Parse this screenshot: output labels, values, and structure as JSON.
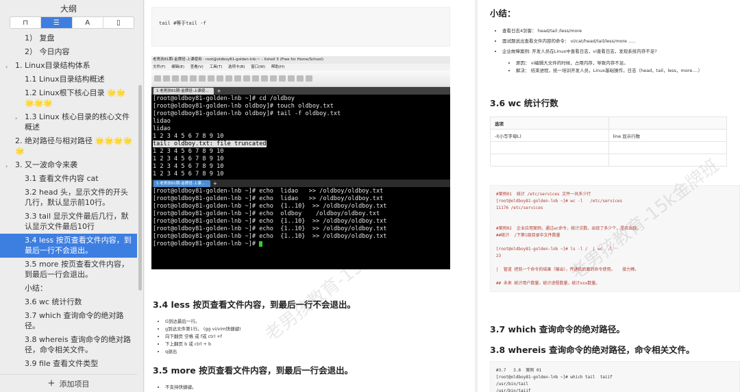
{
  "sidebar": {
    "title": "大纲",
    "tabs": [
      "⊓",
      "☰",
      "A",
      "▯"
    ],
    "outline": [
      {
        "label": "1） 复盘",
        "level": 2,
        "arrow": false
      },
      {
        "label": "2） 今日内容",
        "level": 2,
        "arrow": false
      },
      {
        "label": "1. Linux目录结构体系",
        "level": 1,
        "arrow": true
      },
      {
        "label": "1.1 Linux目录结构概述",
        "level": 2,
        "arrow": false
      },
      {
        "label": "1.2 Linux根下核心目录 🌟🌟🌟🌟🌟",
        "level": 2,
        "arrow": false
      },
      {
        "label": "1.3 Linux 核心目录的核心文件概述",
        "level": 2,
        "arrow": true
      },
      {
        "label": "2. 绝对路径与相对路径 🌟🌟🌟🌟🌟",
        "level": 1,
        "arrow": false
      },
      {
        "label": "3. 又一波命令来袭",
        "level": 1,
        "arrow": true
      },
      {
        "label": "3.1 查看文件内容 cat",
        "level": 2,
        "arrow": false
      },
      {
        "label": "3.2 head 头，显示文件的开头几行，默认显示前10行。",
        "level": 2,
        "arrow": false
      },
      {
        "label": "3.3 tail 显示文件最后几行，默认显示文件最后10行",
        "level": 2,
        "arrow": false
      },
      {
        "label": "3.4 less 按页查看文件内容，到最后一行不会退出。",
        "level": 2,
        "arrow": false,
        "selected": true
      },
      {
        "label": "3.5 more 按页查看文件内容，到最后一行会退出。",
        "level": 2,
        "arrow": false
      },
      {
        "label": "小结：",
        "level": 2,
        "arrow": false
      },
      {
        "label": "3.6 wc 统计行数",
        "level": 2,
        "arrow": false
      },
      {
        "label": "3.7 which 查询命令的绝对路径。",
        "level": 2,
        "arrow": false
      },
      {
        "label": "3.8 whereis 查询命令的绝对路径，命令相关文件。",
        "level": 2,
        "arrow": false
      },
      {
        "label": "3.9 file 查看文件类型",
        "level": 2,
        "arrow": false
      }
    ],
    "add_label": "添加项目"
  },
  "left_page": {
    "top_code": "tail  #等于tail -f",
    "xshell": {
      "title": "老男孩81期-金牌班-上课使用 - root@oldboy81-golden-lnb:~ - Xshell 5 (Free for Home/School)",
      "menu": [
        "文件(F)",
        "编辑(E)",
        "查看(V)",
        "工具(T)",
        "选项卡(B)",
        "窗口(W)",
        "帮助(H)"
      ],
      "tab1": "1 老男孩81期-金牌班-上课使...",
      "tab2": "1 老男孩81期-金牌班-上课...",
      "pane1": [
        "[root@oldboy81-golden-lnb ~]# cd /oldboy",
        "[root@oldboy81-golden-lnb oldboy]# touch oldboy.txt",
        "[root@oldboy81-golden-lnb oldboy]# tail -f oldboy.txt",
        "lidao",
        "lidao",
        "1 2 3 4 5 6 7 8 9 10",
        "tail: oldboy.txt: file truncated",
        "1 2 3 4 5 6 7 8 9 10",
        "1 2 3 4 5 6 7 8 9 10",
        "1 2 3 4 5 6 7 8 9 10",
        "1 2 3 4 5 6 7 8 9 10"
      ],
      "pane2": [
        "[root@oldboy81-golden-lnb ~]# echo  lidao   >> /oldboy/oldboy.txt",
        "[root@oldboy81-golden-lnb ~]# echo  lidao   >> /oldboy/oldboy.txt",
        "[root@oldboy81-golden-lnb ~]# echo  {1..10}  >> /oldboy/oldboy.txt",
        "[root@oldboy81-golden-lnb ~]# echo  oldboy    /oldboy/oldboy.txt",
        "[root@oldboy81-golden-lnb ~]# echo  {1..10}  >> /oldboy/oldboy.txt",
        "[root@oldboy81-golden-lnb ~]# echo  {1..10}  >> /oldboy/oldboy.txt",
        "[root@oldboy81-golden-lnb ~]# echo  {1..10}  >> /oldboy/oldboy.txt",
        "[root@oldboy81-golden-lnb ~]# "
      ]
    },
    "h_less": "3.4 less 按页查看文件内容，到最后一行不会退出。",
    "less_bullets": [
      "G到达最后一行。",
      "g到达文件第1行。  (gg vi/vim快捷键)",
      "向下翻页 空格 或 f或   ctrl +f",
      "下上翻页 b 或           ctrl + b",
      "q退出"
    ],
    "h_more": "3.5 more 按页查看文件内容，到最后一行会退出。",
    "more_bullets": [
      "不支持快捷键。"
    ]
  },
  "right_page": {
    "h_summary": "小结：",
    "summary_bullets": [
      "查看日志4剑客： head/tail /less/more",
      "面试题说出查看文件内容的命令：  vi/cat/head/tail/less/more  .....",
      "企业故障案例: 开发人员在Linux中查看日志，vi查看日志，发现系统内存不足?"
    ],
    "summary_sub": [
      "原因： vi编辑大文件的时候，占用内存，导致内存不足。",
      "解决： 结束进程，统一培训开发人员，Linux基础操作，日志（head，tail，less，more....）"
    ],
    "h_wc": "3.6 wc 统计行数",
    "wc_table": [
      [
        "选项",
        ""
      ],
      [
        "-l(小写字母L)",
        "line 显示行数"
      ],
      [
        "",
        ""
      ],
      [
        "",
        ""
      ]
    ],
    "wc_code": [
      "#案例01  统计 /etc/services 文件一共多少行",
      "[root@oldboy81-golden-lnb ~]# wc -l   /etc/services",
      "11176 /etc/services",
      "",
      "",
      "#案例02  企业应用案例，通过wc命令，统计次数，出现了多少个，是否出现。",
      "##统计  /下第1级目录中文件数量",
      "",
      "[root@oldboy81-golden-lnb ~]# ls -l /  | wc  -l",
      "23",
      "",
      "|  管道 把前一个命令的结果（输出），传递给后面的命令使用。   接力棒。",
      "",
      "## 未来 统计用户数量，统计进程数量，统计xxx数量。"
    ],
    "h_which": "3.7 which 查询命令的绝对路径。",
    "h_whereis": "3.8 whereis 查询命令的绝对路径，命令相关文件。",
    "which_code": [
      "#3.7   3.8  案例 01",
      "[root@oldboy81-golden-lnb ~]# which tail  taiif",
      "/usr/bin/tail",
      "/usr/bin/taiif"
    ]
  },
  "watermark": "老男孩教育-15k金牌班"
}
